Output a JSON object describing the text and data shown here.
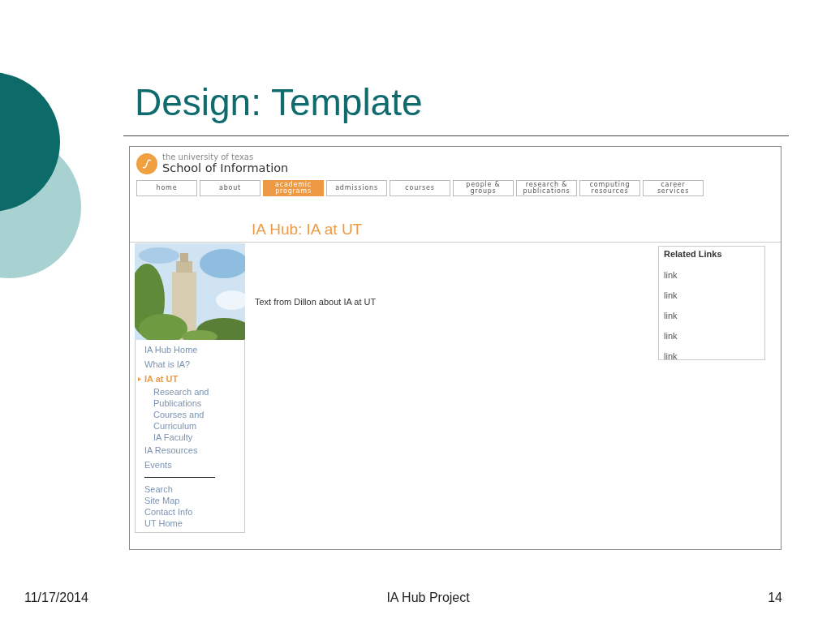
{
  "slide": {
    "title": "Design: Template"
  },
  "site": {
    "logo_small": "the university of texas",
    "logo_name": "School of Information",
    "nav": [
      {
        "label": "home",
        "selected": false
      },
      {
        "label": "about",
        "selected": false
      },
      {
        "label": "academic programs",
        "selected": true
      },
      {
        "label": "admissions",
        "selected": false
      },
      {
        "label": "courses",
        "selected": false
      },
      {
        "label": "people & groups",
        "selected": false
      },
      {
        "label": "research & publications",
        "selected": false
      },
      {
        "label": "computing resources",
        "selected": false
      },
      {
        "label": "career services",
        "selected": false
      }
    ],
    "page_title": "IA Hub: IA at UT",
    "sidebar": {
      "items": [
        {
          "label": "IA Hub Home",
          "selected": false
        },
        {
          "label": "What is IA?",
          "selected": false
        },
        {
          "label": "IA at UT",
          "selected": true,
          "children": [
            {
              "label": "Research and Publications",
              "selected": false
            },
            {
              "label": "Courses and Curriculum",
              "selected": false
            },
            {
              "label": "IA Faculty",
              "selected": false
            }
          ]
        },
        {
          "label": "IA Resources",
          "selected": false
        },
        {
          "label": "Events",
          "selected": false
        }
      ],
      "utility_links": [
        "Search",
        "Site Map",
        "Contact Info",
        "UT Home"
      ]
    },
    "body_text": "Text from Dillon about IA at UT",
    "related": {
      "title": "Related Links",
      "links": [
        "link",
        "link",
        "link",
        "link",
        "link"
      ]
    }
  },
  "footer": {
    "date": "11/17/2014",
    "title": "IA Hub Project",
    "page": "14"
  }
}
